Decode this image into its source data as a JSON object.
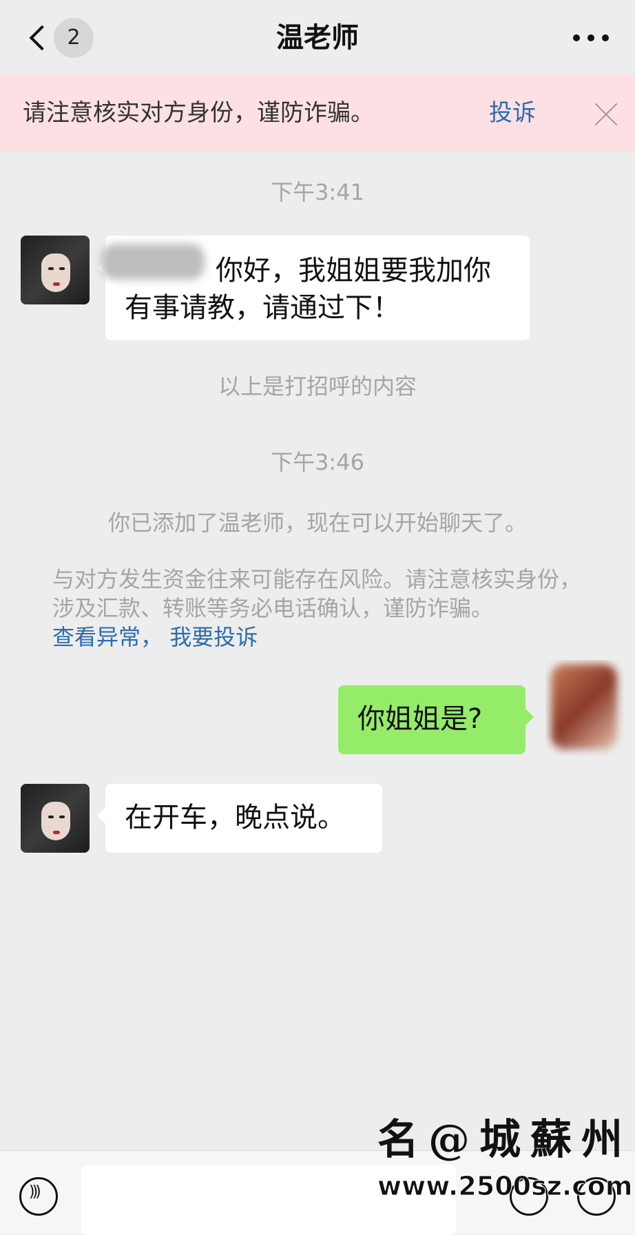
{
  "header": {
    "unread_count": "2",
    "title": "温老师"
  },
  "warning_banner": {
    "text": "请注意核实对方身份，谨防诈骗。",
    "complain_label": "投诉"
  },
  "messages": {
    "time1": "下午3:41",
    "greeting": "你好，我姐姐要我加你有事请教，请通过下！",
    "greeting_note": "以上是打招呼的内容",
    "time2": "下午3:46",
    "added_notice": "你已添加了温老师，现在可以开始聊天了。",
    "risk_notice": "与对方发生资金往来可能存在风险。请注意核实身份，涉及汇款、转账等务必电话确认，谨防诈骗。",
    "link_check": "查看异常",
    "link_sep": "，",
    "link_complain": "我要投诉",
    "my_message": "你姐姐是?",
    "reply": "在开车，晚点说。"
  },
  "watermark": {
    "top": "名@城蘇州",
    "bottom": "www.2500sz.com"
  },
  "colors": {
    "background": "#ededed",
    "banner": "#fde0e4",
    "link": "#2b6cb0",
    "my_bubble": "#95ec69"
  }
}
